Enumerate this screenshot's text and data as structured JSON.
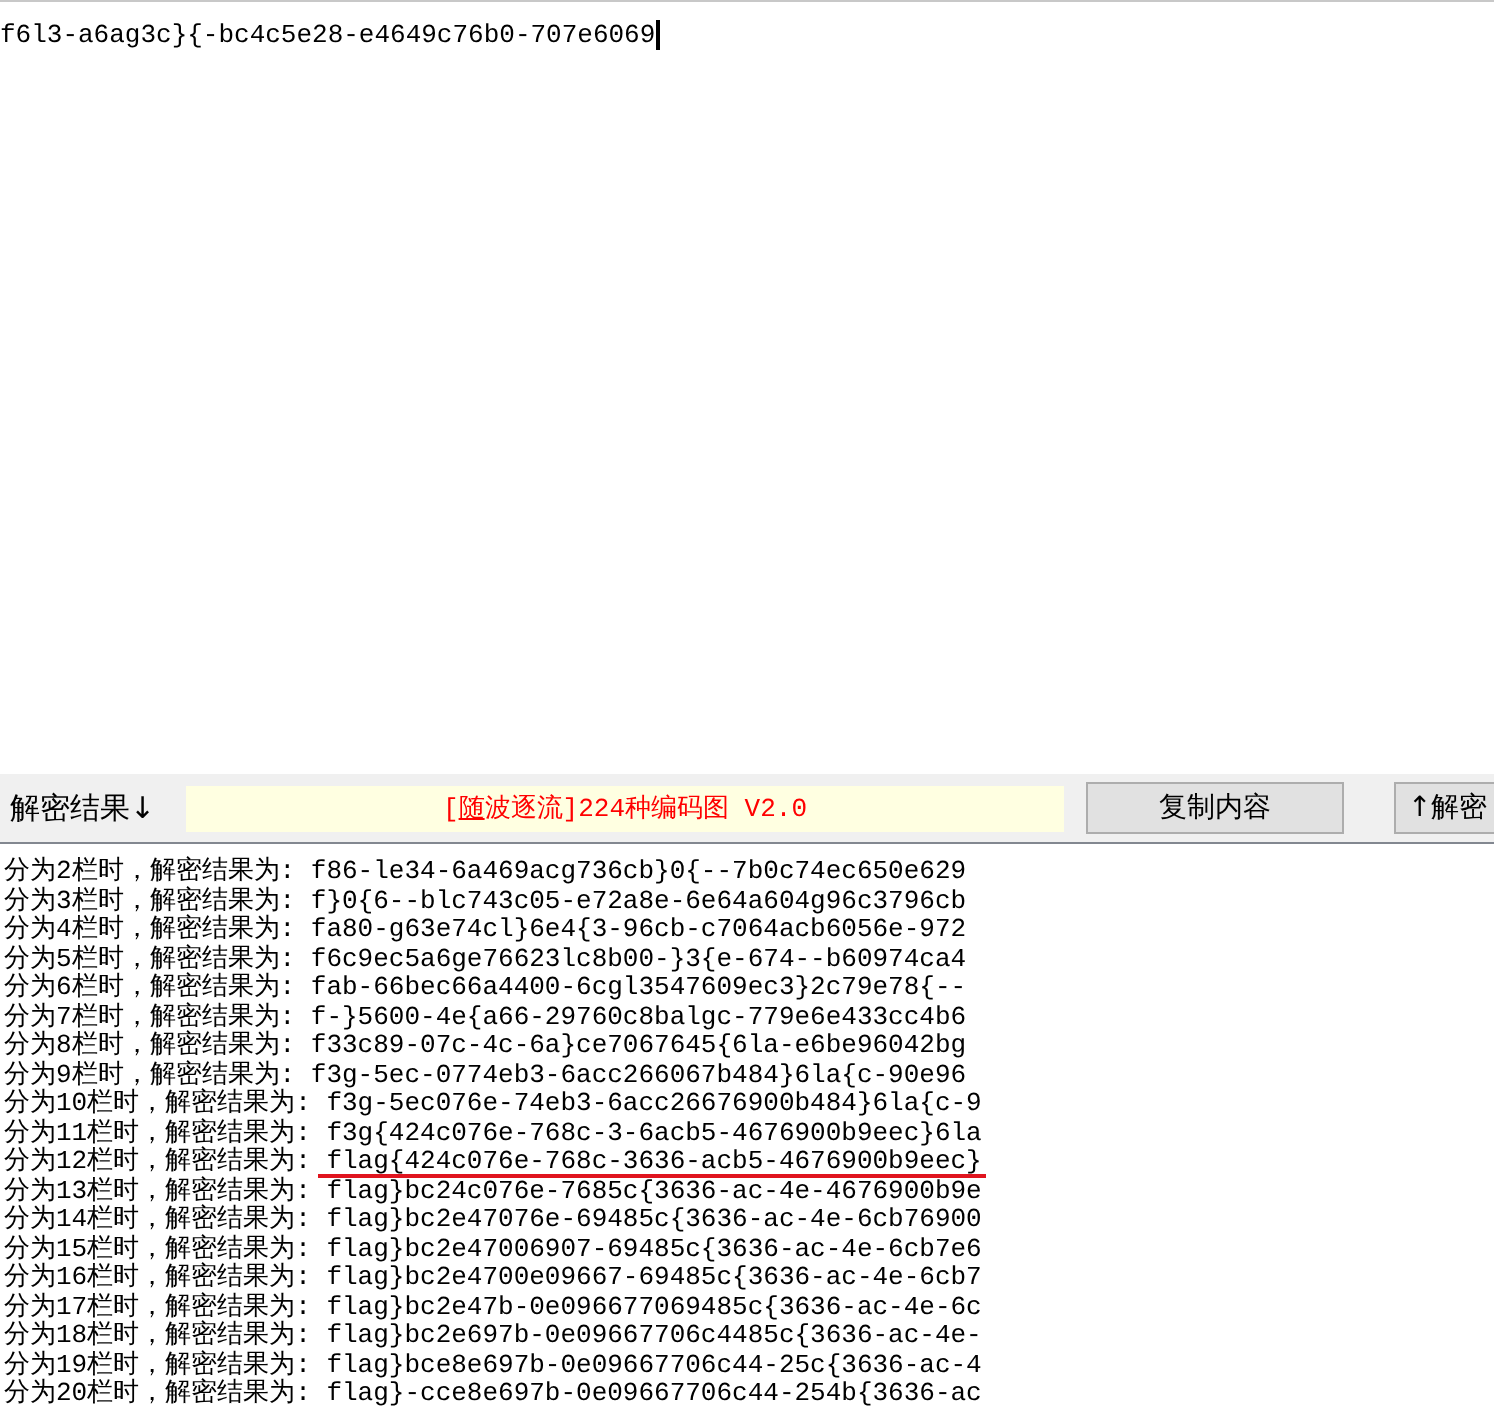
{
  "editor": {
    "text": "f6l3-a6ag3c}{-bc4c5e28-e4649c76b0-707e6069",
    "focused": true
  },
  "toolbar": {
    "label": "解密结果↓",
    "banner": {
      "before": "[",
      "accelerator": "随",
      "after": "波逐流]224种编码图 V2.0"
    },
    "buttons": [
      {
        "label": "复制内容"
      },
      {
        "label": "↑解密"
      }
    ]
  },
  "results": [
    {
      "text": "分为2栏时，解密结果为: f86-le34-6a469acg736cb}0{--7b0c74ec650e629",
      "highlighted": false
    },
    {
      "text": "分为3栏时，解密结果为: f}0{6--blc743c05-e72a8e-6e64a604g96c3796cb",
      "highlighted": false
    },
    {
      "text": "分为4栏时，解密结果为: fa80-g63e74cl}6e4{3-96cb-c7064acb6056e-972",
      "highlighted": false
    },
    {
      "text": "分为5栏时，解密结果为: f6c9ec5a6ge76623lc8b00-}3{e-674--b60974ca4",
      "highlighted": false
    },
    {
      "text": "分为6栏时，解密结果为: fab-66bec66a4400-6cgl3547609ec3}2c79e78{--",
      "highlighted": false
    },
    {
      "text": "分为7栏时，解密结果为: f-}5600-4e{a66-29760c8balgc-779e6e433cc4b6",
      "highlighted": false
    },
    {
      "text": "分为8栏时，解密结果为: f33c89-07c-4c-6a}ce7067645{6la-e6be96042bg",
      "highlighted": false
    },
    {
      "text": "分为9栏时，解密结果为: f3g-5ec-0774eb3-6acc266067b484}6la{c-90e96",
      "highlighted": false
    },
    {
      "text": "分为10栏时，解密结果为: f3g-5ec076e-74eb3-6acc26676900b484}6la{c-9",
      "highlighted": false
    },
    {
      "text": "分为11栏时，解密结果为: f3g{424c076e-768c-3-6acb5-4676900b9eec}6la",
      "highlighted": false
    },
    {
      "text": "分为12栏时，解密结果为: flag{424c076e-768c-3636-acb5-4676900b9eec}",
      "highlighted": true
    },
    {
      "text": "分为13栏时，解密结果为: flag}bc24c076e-7685c{3636-ac-4e-4676900b9e",
      "highlighted": false
    },
    {
      "text": "分为14栏时，解密结果为: flag}bc2e47076e-69485c{3636-ac-4e-6cb76900",
      "highlighted": false
    },
    {
      "text": "分为15栏时，解密结果为: flag}bc2e47006907-69485c{3636-ac-4e-6cb7e6",
      "highlighted": false
    },
    {
      "text": "分为16栏时，解密结果为: flag}bc2e4700e09667-69485c{3636-ac-4e-6cb7",
      "highlighted": false
    },
    {
      "text": "分为17栏时，解密结果为: flag}bc2e47b-0e096677069485c{3636-ac-4e-6c",
      "highlighted": false
    },
    {
      "text": "分为18栏时，解密结果为: flag}bc2e697b-0e09667706c4485c{3636-ac-4e-",
      "highlighted": false
    },
    {
      "text": "分为19栏时，解密结果为: flag}bce8e697b-0e09667706c44-25c{3636-ac-4",
      "highlighted": false
    },
    {
      "text": "分为20栏时，解密结果为: flag}-cce8e697b-0e09667706c44-254b{3636-ac",
      "highlighted": false
    }
  ]
}
